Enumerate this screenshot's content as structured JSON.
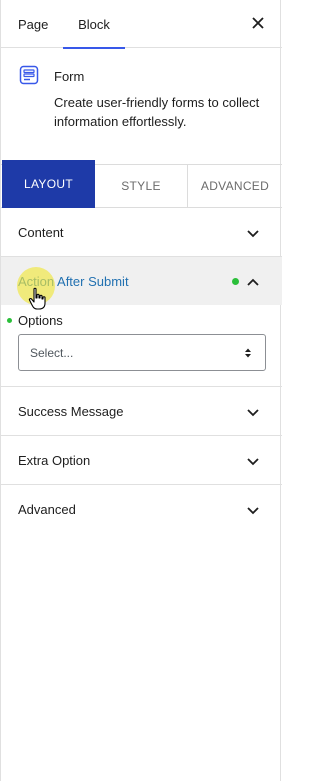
{
  "header": {
    "tabs": [
      {
        "label": "Page",
        "active": false
      },
      {
        "label": "Block",
        "active": true
      }
    ],
    "close_icon": "close-icon"
  },
  "block": {
    "icon": "form-icon",
    "title": "Form",
    "description": "Create user-friendly forms to collect information effortlessly."
  },
  "section_tabs": [
    {
      "label": "LAYOUT",
      "active": true
    },
    {
      "label": "STYLE",
      "active": false
    },
    {
      "label": "ADVANCED",
      "active": false
    }
  ],
  "panels": {
    "content": {
      "label": "Content"
    },
    "action_after_submit": {
      "label": "Action After Submit",
      "expanded": true,
      "options_label": "Options",
      "select_value": "Select..."
    },
    "success_message": {
      "label": "Success Message"
    },
    "extra_option": {
      "label": "Extra Option"
    },
    "advanced": {
      "label": "Advanced"
    }
  },
  "colors": {
    "accent": "#3858e9",
    "active_tab_bg": "#1e3aa8",
    "link": "#2271b1",
    "status_dot": "#2bbf3a"
  }
}
